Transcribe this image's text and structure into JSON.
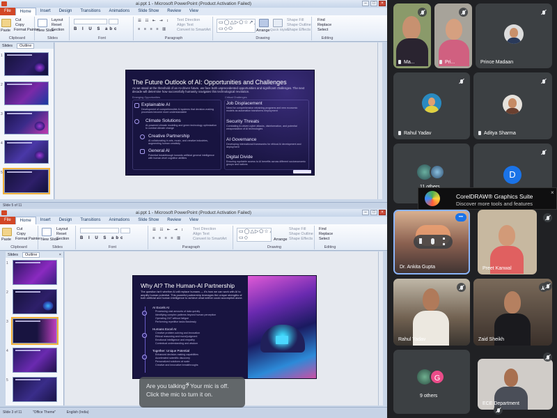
{
  "window1": {
    "title": "ai.ppt 1 - Microsoft PowerPoint (Product Activation Failed)",
    "tabs": [
      "File",
      "Home",
      "Insert",
      "Design",
      "Transitions",
      "Animations",
      "Slide Show",
      "Review",
      "View"
    ],
    "ribbon": {
      "paste": "Paste",
      "cut": "Cut",
      "copy": "Copy",
      "format_painter": "Format Painter",
      "clipboard": "Clipboard",
      "new_slide": "New Slide",
      "layout": "Layout",
      "reset": "Reset",
      "section": "Section",
      "slides": "Slides",
      "font": "Font",
      "paragraph": "Paragraph",
      "text_direction": "Text Direction",
      "align_text": "Align Text",
      "convert_smartart": "Convert to SmartArt",
      "drawing": "Drawing",
      "arrange": "Arrange",
      "quick_styles": "Quick Styles",
      "shape_fill": "Shape Fill",
      "shape_outline": "Shape Outline",
      "shape_effects": "Shape Effects",
      "find": "Find",
      "replace": "Replace",
      "select": "Select",
      "editing": "Editing"
    },
    "panel_tabs": [
      "Slides",
      "Outline"
    ],
    "slide_numbers": [
      "1",
      "2",
      "3",
      "4",
      "5"
    ],
    "status": "Slide 5 of 11",
    "slide": {
      "title": "The Future Outlook of AI: Opportunities and Challenges",
      "subtitle": "As we stand at the threshold of an AI-driven future, we face both unprecedented opportunities and significant challenges. The next decade will determine how successfully humanity navigates this technological revolution.",
      "left_header": "Emerging Opportunities",
      "right_header": "Critical Challenges",
      "left_items": [
        {
          "head": "Explainable AI",
          "text": "Development of comprehensible AI systems that decision-making processes become more understandable"
        },
        {
          "head": "Climate Solutions",
          "text": "AI-powered climate modeling and green technology optimization to combat climate change"
        },
        {
          "head": "Creative Partnership",
          "text": "AI collaborating in arts, music, and creative industries, augmenting human creativity"
        },
        {
          "head": "General AI",
          "text": "Potential breakthrough towards artificial general intelligence with human-level cognitive abilities"
        }
      ],
      "right_items": [
        {
          "head": "Job Displacement",
          "text": "Need for comprehensive retraining programs and new economic models as automation transforms employment"
        },
        {
          "head": "Security Threats",
          "text": "Combating AI-driven cyber attacks, disinformation, and potential weaponization of AI technologies"
        },
        {
          "head": "AI Governance",
          "text": "Developing international frameworks for ethical AI development and deployment"
        },
        {
          "head": "Digital Divide",
          "text": "Ensuring equitable access to AI benefits across different socioeconomic groups and nations"
        }
      ]
    }
  },
  "window2": {
    "title": "ai.ppt 1 - Microsoft PowerPoint (Product Activation Failed)",
    "tabs": [
      "File",
      "Home",
      "Insert",
      "Design",
      "Transitions",
      "Animations",
      "Slide Show",
      "Review",
      "View"
    ],
    "panel_tabs": [
      "Slides",
      "Outline"
    ],
    "slide_numbers": [
      "1",
      "2",
      "3",
      "4",
      "5"
    ],
    "status": "Slide 3 of 11",
    "status_theme": "\"Office Theme\"",
    "status_lang": "English (India)",
    "slide": {
      "title": "Why AI? The Human-AI Partnership",
      "subtitle": "The question isn't whether AI will replace humans — it's how we can work with AI to amplify human potential. This powerful partnership leverages the unique strengths of both artificial and human intelligence to achieve what neither could accomplish alone.",
      "sections": [
        {
          "head": "AI Excels At",
          "items": [
            "Processing vast amounts of data quickly",
            "Identifying complex patterns beyond human perception",
            "Operating 24/7 without fatigue",
            "Performing repetitive tasks flawlessly"
          ]
        },
        {
          "head": "Humans Excel At",
          "items": [
            "Creative problem-solving and innovation",
            "Ethical reasoning and moral judgment",
            "Emotional intelligence and empathy",
            "Contextual understanding and wisdom"
          ]
        },
        {
          "head": "Together: Unique Potential",
          "items": [
            "Enhanced decision-making capabilities",
            "Accelerated scientific discovery",
            "Personalized solutions at scale",
            "Creative and innovative breakthroughs"
          ]
        }
      ]
    }
  },
  "meet": {
    "participants": [
      {
        "name": "Ma...",
        "muted": true
      },
      {
        "name": "Pri...",
        "muted": true
      },
      {
        "name": "",
        "muted": true
      },
      {
        "name": "Prince Madaan",
        "muted": false
      },
      {
        "name": "Rahul Yadav",
        "muted": true
      },
      {
        "name": "Aditya Sharma",
        "muted": true
      },
      {
        "name": "11 others",
        "muted": false
      },
      {
        "name": "",
        "muted": true
      },
      {
        "name": "Dr. Ankita Gupta",
        "muted": false
      },
      {
        "name": "Preet Kanwal",
        "muted": true
      },
      {
        "name": "Rahul Yadav",
        "muted": true
      },
      {
        "name": "Zaid Sheikh",
        "muted": true
      },
      {
        "name": "9 others",
        "muted": false
      },
      {
        "name": "ECE Department",
        "muted": true
      }
    ],
    "avatar_letters": {
      "d": "D",
      "g": "G"
    },
    "ad": {
      "title": "CorelDRAW® Graphics Suite",
      "subtitle": "Discover more tools and features",
      "close": "×"
    },
    "toast": "Are you talking? Your mic is off. Click the mic to turn it on.",
    "toast_close": "×",
    "more_menu": "•••",
    "colors": {
      "tile_bg": "#3c4043",
      "meet_bg": "#202124",
      "speaking_border": "#8ab4f8",
      "avatar_blue": "#1a73e8",
      "avatar_pink": "#ea4c89"
    }
  }
}
